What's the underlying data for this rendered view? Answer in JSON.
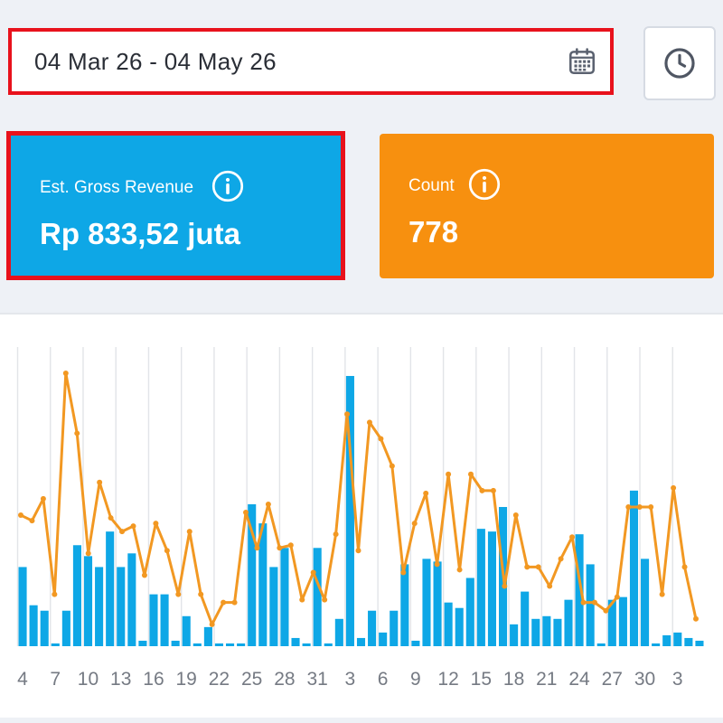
{
  "date_range": {
    "value": "04 Mar 26 - 04 May 26",
    "calendar_icon": "calendar-icon"
  },
  "clock_button": {
    "icon": "clock-icon"
  },
  "cards": {
    "revenue": {
      "label": "Est. Gross Revenue",
      "value": "Rp 833,52 juta",
      "color": "#0ea7e6",
      "icon": "info-icon"
    },
    "count": {
      "label": "Count",
      "value": "778",
      "color": "#f7900f",
      "icon": "info-icon"
    }
  },
  "chart_data": {
    "type": "bar",
    "x_tick_labels": [
      "4",
      "7",
      "10",
      "13",
      "16",
      "19",
      "22",
      "25",
      "28",
      "31",
      "3",
      "6",
      "9",
      "12",
      "15",
      "18",
      "21",
      "24",
      "27",
      "30",
      "3"
    ],
    "series": [
      {
        "type": "bar",
        "color": "#0ea7e6",
        "values": [
          29,
          15,
          13,
          1,
          13,
          37,
          33,
          29,
          42,
          29,
          34,
          2,
          19,
          19,
          2,
          11,
          1,
          7,
          1,
          1,
          1,
          52,
          45,
          29,
          36,
          3,
          1,
          36,
          1,
          10,
          99,
          3,
          13,
          5,
          13,
          30,
          2,
          32,
          31,
          16,
          14,
          25,
          43,
          42,
          51,
          8,
          20,
          10,
          11,
          10,
          17,
          41,
          30,
          1,
          17,
          18,
          57,
          32,
          1,
          4,
          5,
          3,
          2
        ]
      },
      {
        "type": "line",
        "color": "#f29822",
        "values": [
          48,
          46,
          54,
          19,
          100,
          78,
          34,
          60,
          47,
          42,
          44,
          26,
          45,
          35,
          19,
          42,
          19,
          8,
          16,
          16,
          49,
          36,
          52,
          36,
          37,
          17,
          27,
          17,
          41,
          85,
          35,
          82,
          76,
          66,
          27,
          45,
          56,
          30,
          63,
          28,
          63,
          57,
          57,
          22,
          48,
          29,
          29,
          22,
          32,
          40,
          16,
          16,
          13,
          18,
          51,
          51,
          51,
          19,
          58,
          29,
          10
        ]
      }
    ],
    "ylim": [
      0,
      100
    ],
    "grid": "vertical"
  }
}
